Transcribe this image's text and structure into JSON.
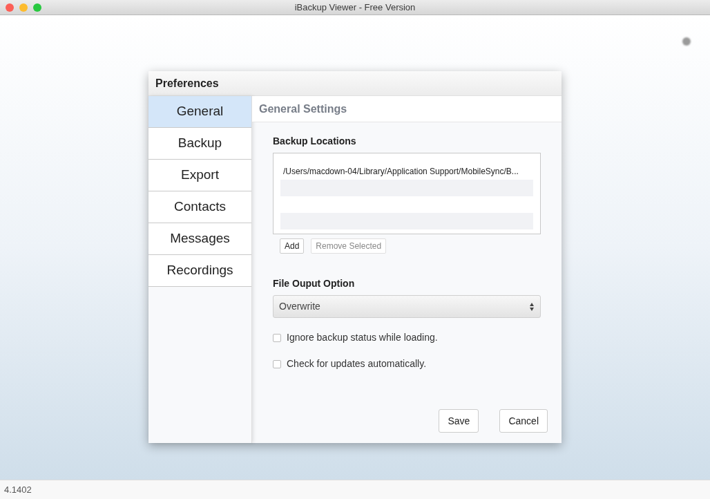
{
  "window": {
    "title": "iBackup Viewer - Free Version"
  },
  "dialog": {
    "title": "Preferences",
    "sidebar": {
      "items": [
        {
          "label": "General",
          "selected": true
        },
        {
          "label": "Backup",
          "selected": false
        },
        {
          "label": "Export",
          "selected": false
        },
        {
          "label": "Contacts",
          "selected": false
        },
        {
          "label": "Messages",
          "selected": false
        },
        {
          "label": "Recordings",
          "selected": false
        }
      ]
    },
    "panel": {
      "title": "General Settings",
      "backup_locations": {
        "label": "Backup Locations",
        "rows": [
          "/Users/macdown-04/Library/Application Support/MobileSync/B..."
        ],
        "buttons": [
          {
            "label": "Add",
            "disabled": false
          },
          {
            "label": "Remove Selected",
            "disabled": true
          }
        ]
      },
      "file_output": {
        "label": "File Ouput Option",
        "value": "Overwrite"
      },
      "options": [
        {
          "label": "Ignore backup status while loading.",
          "checked": false
        },
        {
          "label": "Check for updates automatically.",
          "checked": false
        }
      ],
      "buttons": [
        "Save",
        "Cancel"
      ]
    }
  },
  "status_bar": {
    "version": "4.1402"
  }
}
